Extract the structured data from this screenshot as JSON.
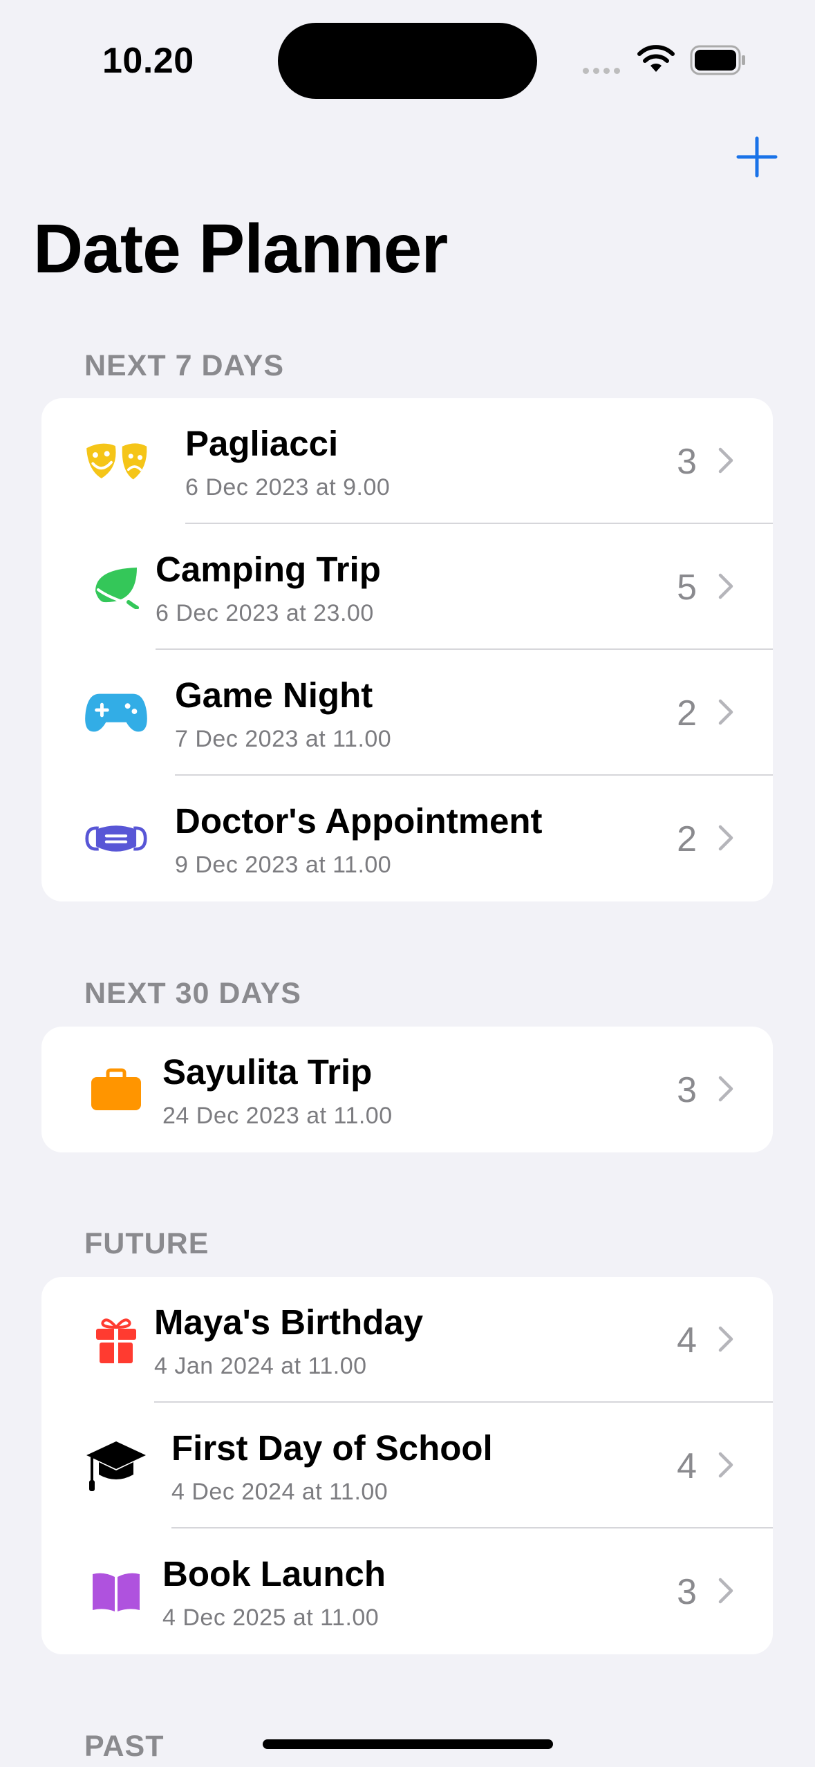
{
  "status_bar": {
    "time": "10.20"
  },
  "nav": {
    "add_icon": "plus-icon",
    "accent_color": "#1A73E8"
  },
  "page": {
    "title": "Date Planner"
  },
  "sections": [
    {
      "header": "NEXT 7 DAYS",
      "items": [
        {
          "title": "Pagliacci",
          "subtitle": "6 Dec 2023 at 9.00",
          "count": "3",
          "icon": "theater-masks-icon",
          "color": "#F5C518"
        },
        {
          "title": "Camping Trip",
          "subtitle": "6 Dec 2023 at 23.00",
          "count": "5",
          "icon": "leaf-icon",
          "color": "#34C759"
        },
        {
          "title": "Game Night",
          "subtitle": "7 Dec 2023 at 11.00",
          "count": "2",
          "icon": "gamecontroller-icon",
          "color": "#32ADE6"
        },
        {
          "title": "Doctor's Appointment",
          "subtitle": "9 Dec 2023 at 11.00",
          "count": "2",
          "icon": "medical-mask-icon",
          "color": "#5856D6"
        }
      ]
    },
    {
      "header": "NEXT 30 DAYS",
      "items": [
        {
          "title": "Sayulita Trip",
          "subtitle": "24 Dec 2023 at 11.00",
          "count": "3",
          "icon": "suitcase-icon",
          "color": "#FF9500"
        }
      ]
    },
    {
      "header": "FUTURE",
      "items": [
        {
          "title": "Maya's Birthday",
          "subtitle": "4 Jan 2024 at 11.00",
          "count": "4",
          "icon": "gift-icon",
          "color": "#FF3B30"
        },
        {
          "title": "First Day of School",
          "subtitle": "4 Dec 2024 at 11.00",
          "count": "4",
          "icon": "graduationcap-icon",
          "color": "#000000"
        },
        {
          "title": "Book Launch",
          "subtitle": "4 Dec 2025 at 11.00",
          "count": "3",
          "icon": "book-icon",
          "color": "#AF52DE"
        }
      ]
    },
    {
      "header": "PAST",
      "items": []
    }
  ]
}
